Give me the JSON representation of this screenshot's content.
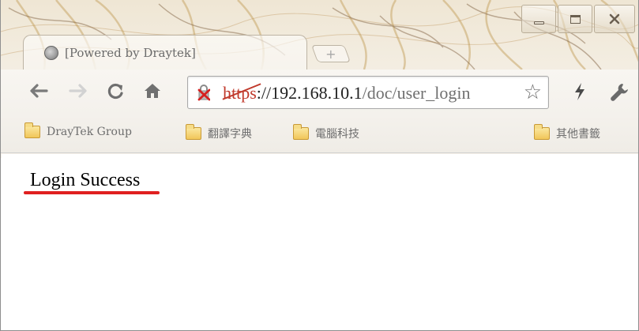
{
  "tab": {
    "title": "[Powered by Draytek]",
    "favicon": "globe-icon",
    "new_tab_icon": "plus-icon"
  },
  "toolbar": {
    "back_icon": "back-arrow-icon",
    "forward_icon": "forward-arrow-icon",
    "reload_icon": "reload-icon",
    "home_icon": "home-icon",
    "url_scheme": "https",
    "url_host": "://192.168.10.1",
    "url_path": "/doc/user_login",
    "security_icon": "broken-lock-icon",
    "bookmark_star_icon": "star-icon",
    "extension_icon": "lightning-bolt-icon",
    "settings_icon": "wrench-icon"
  },
  "bookmarks": {
    "items": [
      {
        "label": "DrayTek Group",
        "icon": "folder-icon"
      },
      {
        "label": "翻譯字典",
        "icon": "folder-icon"
      },
      {
        "label": "電腦科技",
        "icon": "folder-icon"
      }
    ],
    "other": {
      "label": "其他書籤",
      "icon": "folder-icon"
    }
  },
  "page": {
    "message": "Login Success"
  },
  "colors": {
    "insecure_scheme": "#c0392b",
    "highlight_underline": "#e02020"
  }
}
